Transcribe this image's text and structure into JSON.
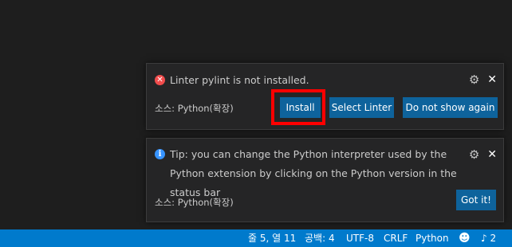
{
  "notifications": [
    {
      "message": "Linter pylint is not installed.",
      "source": "소스: Python(확장)",
      "icon": "error-icon",
      "actions": [
        "Install",
        "Select Linter",
        "Do not show again"
      ]
    },
    {
      "message": "Tip: you can change the Python interpreter used by the Python extension by clicking on the Python version in the status bar",
      "source": "소스: Python(확장)",
      "icon": "info-icon",
      "actions": [
        "Got it!"
      ]
    }
  ],
  "icons": {
    "error_glyph": "✕",
    "info_glyph": "i",
    "gear_glyph": "⚙",
    "close_glyph": "✕",
    "smiley_glyph": "☻",
    "bell_glyph": "🔔"
  },
  "status_bar": {
    "position": "줄 5, 열 11",
    "spaces": "공백: 4",
    "encoding": "UTF-8",
    "eol": "CRLF",
    "language": "Python",
    "notification_count": "2"
  },
  "colors": {
    "editor_bg": "#1e1e1e",
    "toast_bg": "#252526",
    "button_bg": "#0e639c",
    "statusbar_bg": "#007acc",
    "error": "#f14c4c",
    "info": "#3794ff",
    "highlight": "#ff0000"
  }
}
